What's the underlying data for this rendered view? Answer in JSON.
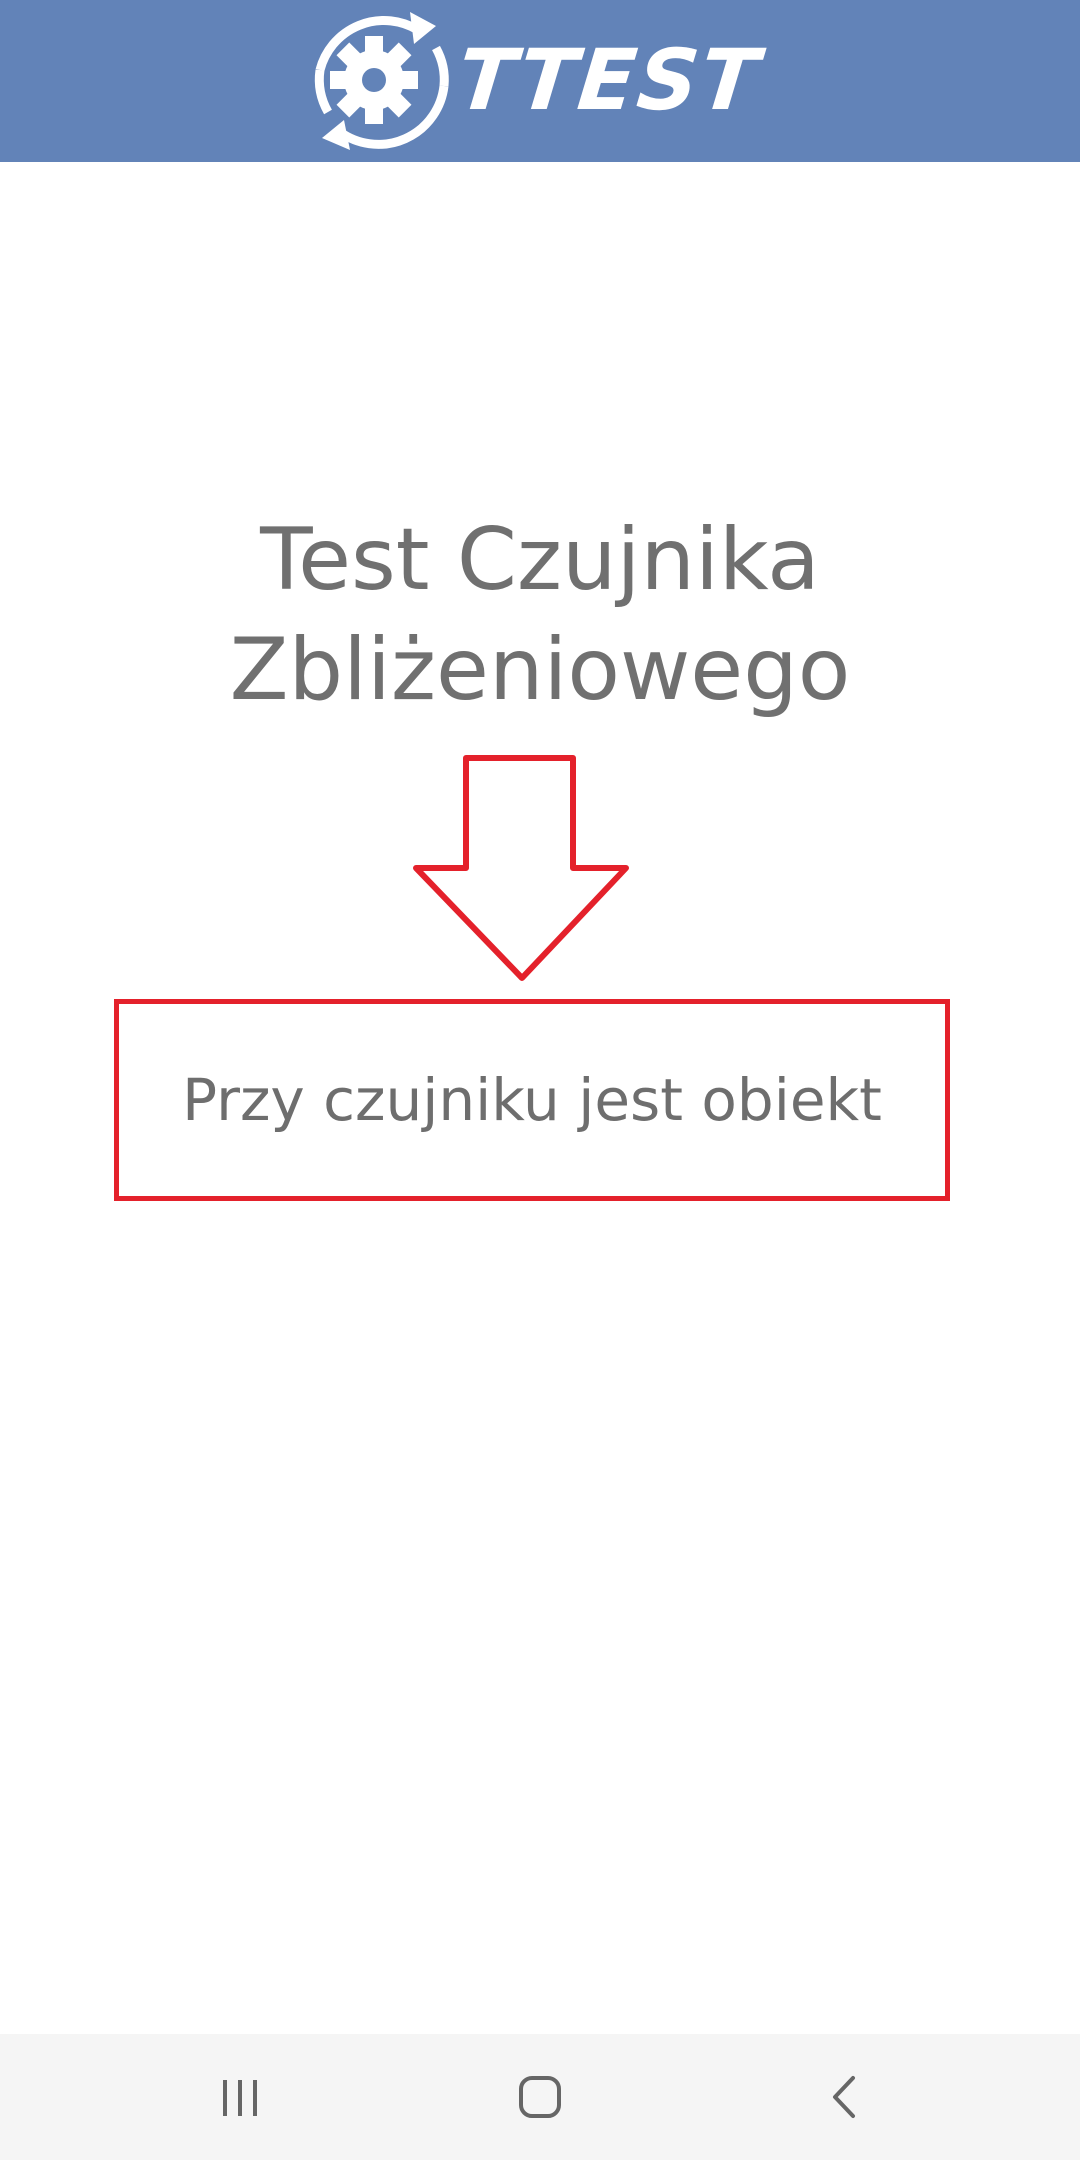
{
  "header": {
    "logo_text": "TTEST",
    "background_color": "#6283b8"
  },
  "main": {
    "title_line1": "Test Czujnika",
    "title_line2": "Zbliżeniowego",
    "arrow_icon": "arrow-down-outline-icon",
    "status_text": "Przy czujniku jest obiekt",
    "accent_color": "#e4212b"
  },
  "nav": {
    "recents_icon": "recents-icon",
    "home_icon": "home-icon",
    "back_icon": "back-icon"
  }
}
